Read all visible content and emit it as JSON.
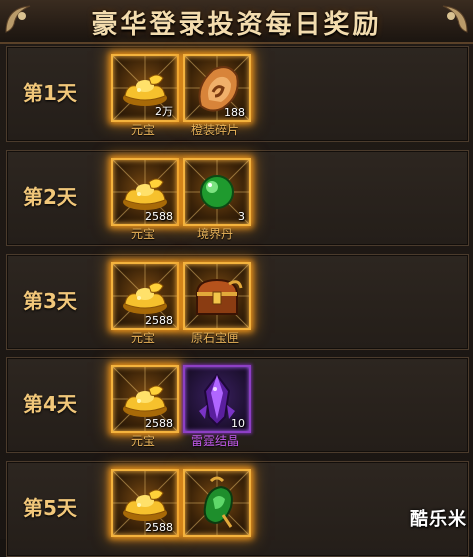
{
  "title": "豪华登录投资每日奖励",
  "watermark": "酷乐米",
  "days": [
    {
      "day": "第1天",
      "rewards": [
        {
          "name": "元宝",
          "count": "2万",
          "icon": "gold-ingot-icon",
          "rarity": "gold"
        },
        {
          "name": "橙装碎片",
          "count": "188",
          "icon": "orange-equip-fragment-icon",
          "rarity": "gold"
        }
      ]
    },
    {
      "day": "第2天",
      "rewards": [
        {
          "name": "元宝",
          "count": "2588",
          "icon": "gold-ingot-icon",
          "rarity": "gold"
        },
        {
          "name": "境界丹",
          "count": "3",
          "icon": "green-pill-icon",
          "rarity": "gold"
        }
      ]
    },
    {
      "day": "第3天",
      "rewards": [
        {
          "name": "元宝",
          "count": "2588",
          "icon": "gold-ingot-icon",
          "rarity": "gold"
        },
        {
          "name": "原石宝匣",
          "count": "",
          "icon": "treasure-chest-icon",
          "rarity": "gold"
        }
      ]
    },
    {
      "day": "第4天",
      "rewards": [
        {
          "name": "元宝",
          "count": "2588",
          "icon": "gold-ingot-icon",
          "rarity": "gold"
        },
        {
          "name": "雷霆结晶",
          "count": "10",
          "icon": "purple-crystal-icon",
          "rarity": "purple"
        }
      ]
    },
    {
      "day": "第5天",
      "rewards": [
        {
          "name": "元宝",
          "count": "2588",
          "icon": "gold-ingot-icon",
          "rarity": "gold"
        },
        {
          "name": "",
          "count": "",
          "icon": "jade-pendant-icon",
          "rarity": "gold"
        }
      ]
    }
  ],
  "colors": {
    "day_label": "#f1c77a",
    "item_label_gold": "#e8b35a",
    "item_label_purple": "#c65cf0",
    "slot_border_gold": "#f4b33d",
    "slot_border_purple": "#8d3fc4"
  }
}
